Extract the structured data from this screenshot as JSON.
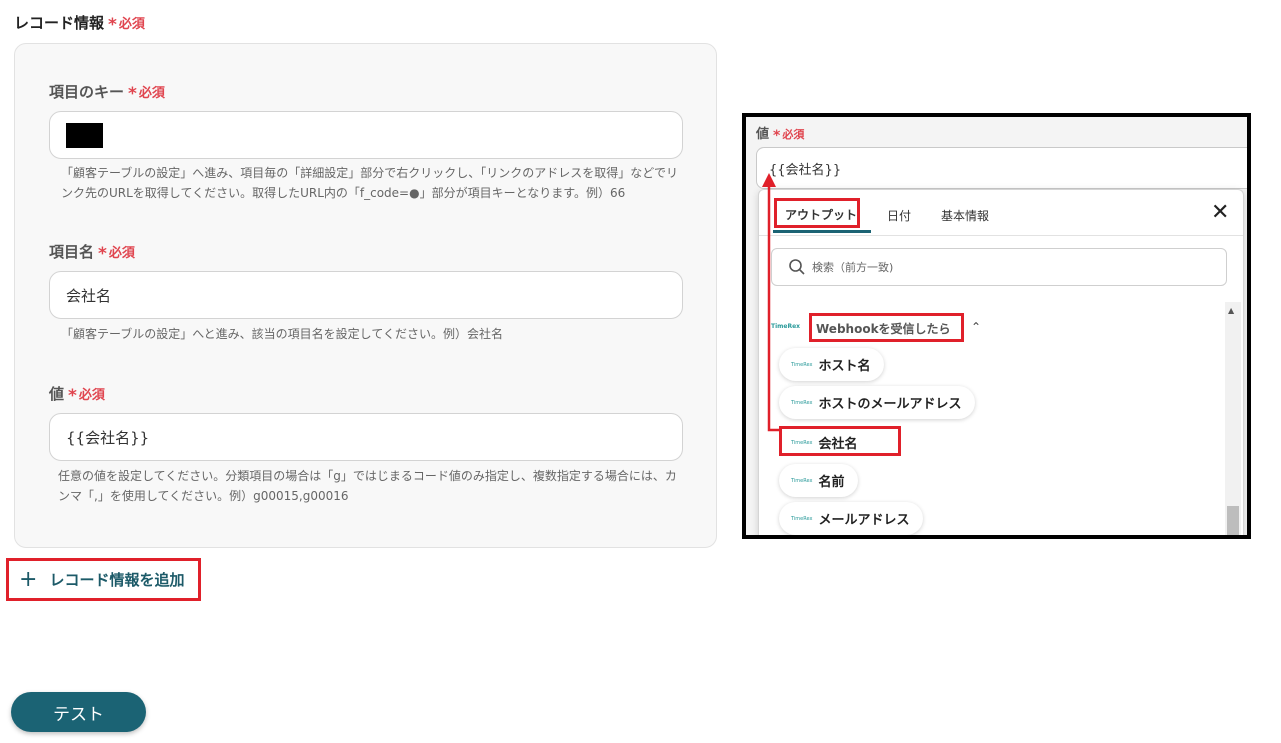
{
  "section": {
    "title": "レコード情報",
    "required": "必須"
  },
  "fields": {
    "key": {
      "label": "項目のキー",
      "required": "必須",
      "help": "「顧客テーブルの設定」へ進み、項目毎の「詳細設定」部分で右クリックし、「リンクのアドレスを取得」などでリンク先のURLを取得してください。取得したURL内の「f_code=●」部分が項目キーとなります。例）66"
    },
    "name": {
      "label": "項目名",
      "required": "必須",
      "value": "会社名",
      "help": "「顧客テーブルの設定」へと進み、該当の項目名を設定してください。例）会社名"
    },
    "value": {
      "label": "値",
      "required": "必須",
      "value": "{{会社名}}",
      "help": "任意の値を設定してください。分類項目の場合は「g」ではじまるコード値のみ指定し、複数指定する場合には、カンマ「,」を使用してください。例）g00015,g00016"
    }
  },
  "add_record_label": "レコード情報を追加",
  "test_button_label": "テスト",
  "inset": {
    "value_label": "値",
    "required": "必須",
    "value_input": "{{会社名}}",
    "tabs": [
      "アウトプット",
      "日付",
      "基本情報"
    ],
    "search_placeholder": "検索（前方一致)",
    "group_logo": "TimeRex",
    "group_title": "Webhookを受信したら",
    "items": [
      "ホスト名",
      "ホストのメールアドレス",
      "会社名",
      "名前",
      "メールアドレス"
    ],
    "item_logo": "TimeRex"
  },
  "colors": {
    "accent": "#1b6374",
    "required": "#e0454f",
    "highlight": "#e0202a"
  }
}
